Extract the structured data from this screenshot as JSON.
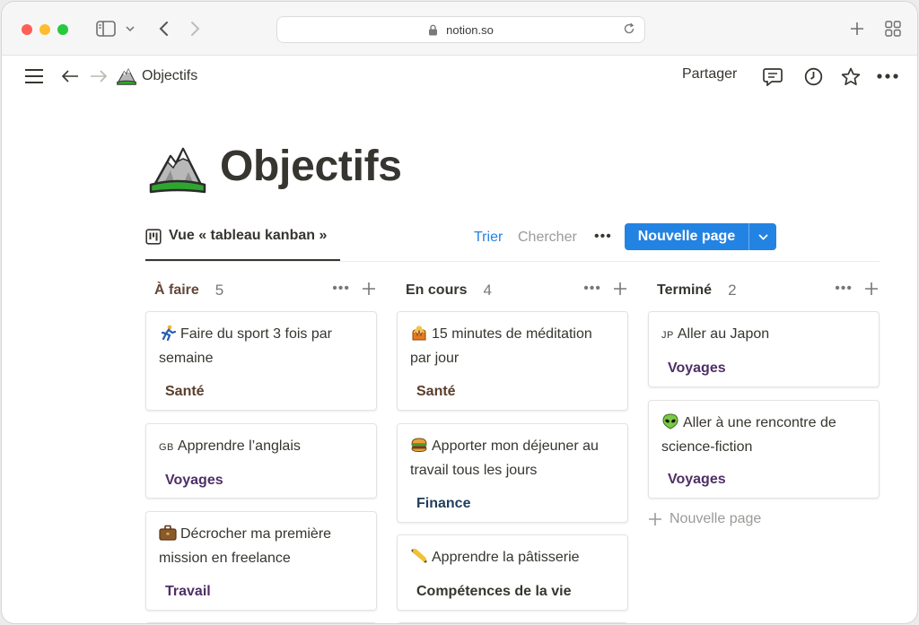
{
  "browser": {
    "url": "notion.so"
  },
  "topbar": {
    "breadcrumb_title": "Objectifs",
    "share_label": "Partager"
  },
  "page": {
    "title": "Objectifs",
    "icon": "mountain-icon"
  },
  "view": {
    "tab_label": "Vue « tableau kanban »",
    "sort_label": "Trier",
    "search_label": "Chercher",
    "more_label": "•••",
    "new_page_label": "Nouvelle page"
  },
  "columns": [
    {
      "title": "À faire",
      "count": "5",
      "title_color": "#64473a",
      "cards": [
        {
          "emoji": "runner-icon",
          "title": "Faire du sport 3 fois par semaine",
          "tag": "Santé"
        },
        {
          "flag": "GB",
          "title": "Apprendre l’anglais",
          "tag": "Voyages"
        },
        {
          "emoji": "briefcase-icon",
          "title": "Décrocher ma première mission en freelance",
          "tag": "Travail"
        }
      ]
    },
    {
      "title": "En cours",
      "count": "4",
      "title_color": "#37352f",
      "cards": [
        {
          "emoji": "praying-person-icon",
          "title": "15 minutes de méditation par jour",
          "tag": "Santé"
        },
        {
          "emoji": "burger-icon",
          "title": "Apporter mon déjeuner au travail tous les jours",
          "tag": "Finance"
        },
        {
          "emoji": "rolling-pin-icon",
          "title": "Apprendre la pâtisserie",
          "tag": "Compétences de la vie"
        }
      ]
    },
    {
      "title": "Terminé",
      "count": "2",
      "title_color": "#37352f",
      "cards": [
        {
          "flag": "JP",
          "title": "Aller au Japon",
          "tag": "Voyages"
        },
        {
          "emoji": "alien-icon",
          "title": "Aller à une rencontre de science-fiction",
          "tag": "Voyages"
        }
      ],
      "new_label": "Nouvelle page"
    }
  ],
  "colors": {
    "accent": "#2383e2",
    "text": "#37352f",
    "muted": "#787774"
  }
}
